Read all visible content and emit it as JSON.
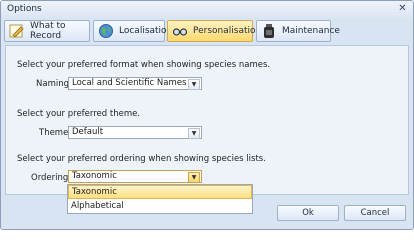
{
  "window": {
    "title": "Options",
    "close_symbol": "✕"
  },
  "tabs": [
    {
      "label": "What to Record",
      "icon": "pencil-icon",
      "active": false
    },
    {
      "label": "Localisation",
      "icon": "globe-icon",
      "active": false
    },
    {
      "label": "Personalisation",
      "icon": "glasses-icon",
      "active": true
    },
    {
      "label": "Maintenance",
      "icon": "jar-icon",
      "active": false
    }
  ],
  "personalisation": {
    "naming": {
      "description": "Select your preferred format when showing species names.",
      "label": "Naming:",
      "value": "Local and Scientific Names"
    },
    "theme": {
      "description": "Select your preferred theme.",
      "label": "Theme:",
      "value": "Default"
    },
    "ordering": {
      "description": "Select your preferred ordering when showing species lists.",
      "label": "Ordering:",
      "value": "Taxonomic",
      "options": [
        "Taxonomic",
        "Alphabetical"
      ],
      "highlighted": "Taxonomic"
    }
  },
  "footer": {
    "ok_label": "Ok",
    "cancel_label": "Cancel"
  },
  "colors": {
    "active_tab": "#ffd96e",
    "highlight": "#ffdf82",
    "panel": "#eef3fa"
  }
}
